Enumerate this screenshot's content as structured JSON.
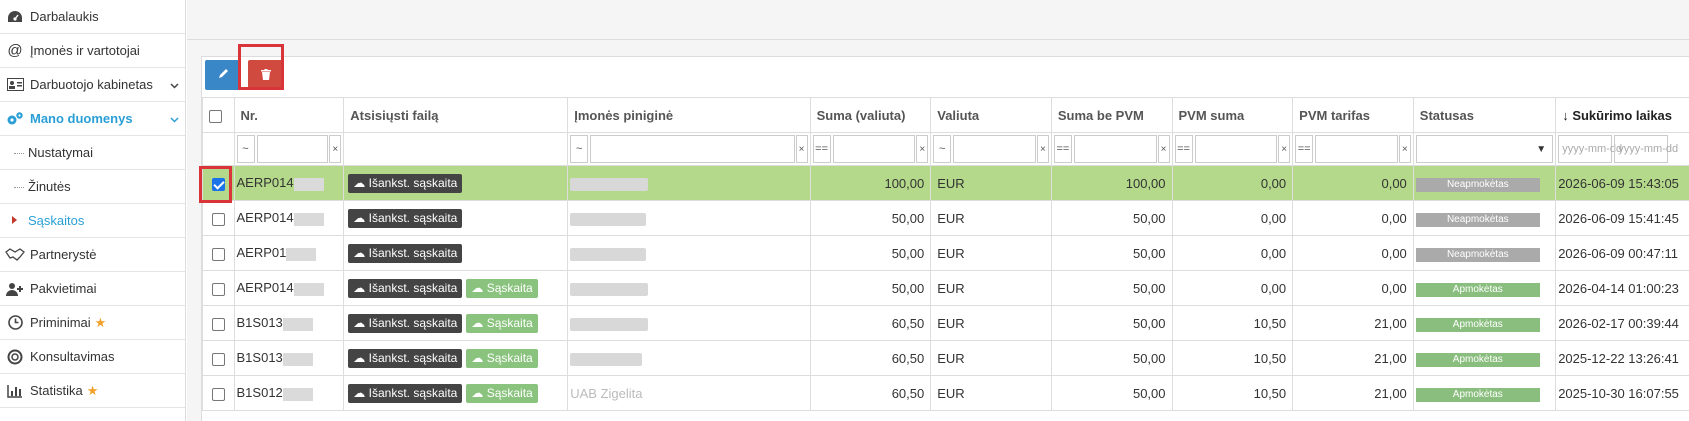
{
  "sidebar": {
    "items": [
      {
        "label": "Darbalaukis",
        "icon": "dashboard-icon"
      },
      {
        "label": "Įmonės ir vartotojai",
        "icon": "at-icon"
      },
      {
        "label": "Darbuotojo kabinetas",
        "icon": "id-card-icon"
      },
      {
        "label": "Mano duomenys",
        "icon": "gears-icon"
      }
    ],
    "sub": [
      "Nustatymai",
      "Žinutės",
      "Sąskaitos"
    ],
    "items2": [
      {
        "label": "Partnerystė",
        "icon": "handshake-icon"
      },
      {
        "label": "Pakvietimai",
        "icon": "user-plus-icon"
      },
      {
        "label": "Priminimai",
        "icon": "clock-icon"
      },
      {
        "label": "Konsultavimas",
        "icon": "lifebuoy-icon"
      },
      {
        "label": "Statistika",
        "icon": "bar-chart-icon"
      }
    ]
  },
  "table": {
    "headers": [
      "Nr.",
      "Atsisiųsti failą",
      "Įmonės piniginė",
      "Suma (valiuta)",
      "Valiuta",
      "Suma be PVM",
      "PVM suma",
      "PVM tarifas",
      "Statusas",
      "Sukūrimo laikas"
    ],
    "filter": {
      "tilde": "~",
      "eq": "==",
      "x": "×",
      "date_ph": "yyyy-mm-dd"
    },
    "dl_label": "Išankst. sąskaita",
    "inv_label": "Sąskaita",
    "rows": [
      {
        "nr": "AERP014",
        "sum": "100,00",
        "cur": "EUR",
        "net": "100,00",
        "vat": "0,00",
        "rate": "0,00",
        "status": "Neapmokėtas",
        "created": "2026-06-09 15:43:05",
        "inv": false,
        "wallet": ""
      },
      {
        "nr": "AERP014",
        "sum": "50,00",
        "cur": "EUR",
        "net": "50,00",
        "vat": "0,00",
        "rate": "0,00",
        "status": "Neapmokėtas",
        "created": "2026-06-09 15:41:45",
        "inv": false,
        "wallet": ""
      },
      {
        "nr": "AERP01",
        "sum": "50,00",
        "cur": "EUR",
        "net": "50,00",
        "vat": "0,00",
        "rate": "0,00",
        "status": "Neapmokėtas",
        "created": "2026-06-09 00:47:11",
        "inv": false,
        "wallet": ""
      },
      {
        "nr": "AERP014",
        "sum": "50,00",
        "cur": "EUR",
        "net": "50,00",
        "vat": "0,00",
        "rate": "0,00",
        "status": "Apmokėtas",
        "created": "2026-04-14 01:00:23",
        "inv": true,
        "wallet": ""
      },
      {
        "nr": "B1S013",
        "sum": "60,50",
        "cur": "EUR",
        "net": "50,00",
        "vat": "10,50",
        "rate": "21,00",
        "status": "Apmokėtas",
        "created": "2026-02-17 00:39:44",
        "inv": true,
        "wallet": ""
      },
      {
        "nr": "B1S013",
        "sum": "60,50",
        "cur": "EUR",
        "net": "50,00",
        "vat": "10,50",
        "rate": "21,00",
        "status": "Apmokėtas",
        "created": "2025-12-22 13:26:41",
        "inv": true,
        "wallet": ""
      },
      {
        "nr": "B1S012",
        "sum": "60,50",
        "cur": "EUR",
        "net": "50,00",
        "vat": "10,50",
        "rate": "21,00",
        "status": "Apmokėtas",
        "created": "2025-10-30 16:07:55",
        "inv": true,
        "wallet": "UAB Zigelita"
      }
    ]
  },
  "colors": {
    "accent": "#2a9fd6",
    "selected_row": "#b4d98a",
    "highlight": "#d9343a"
  }
}
